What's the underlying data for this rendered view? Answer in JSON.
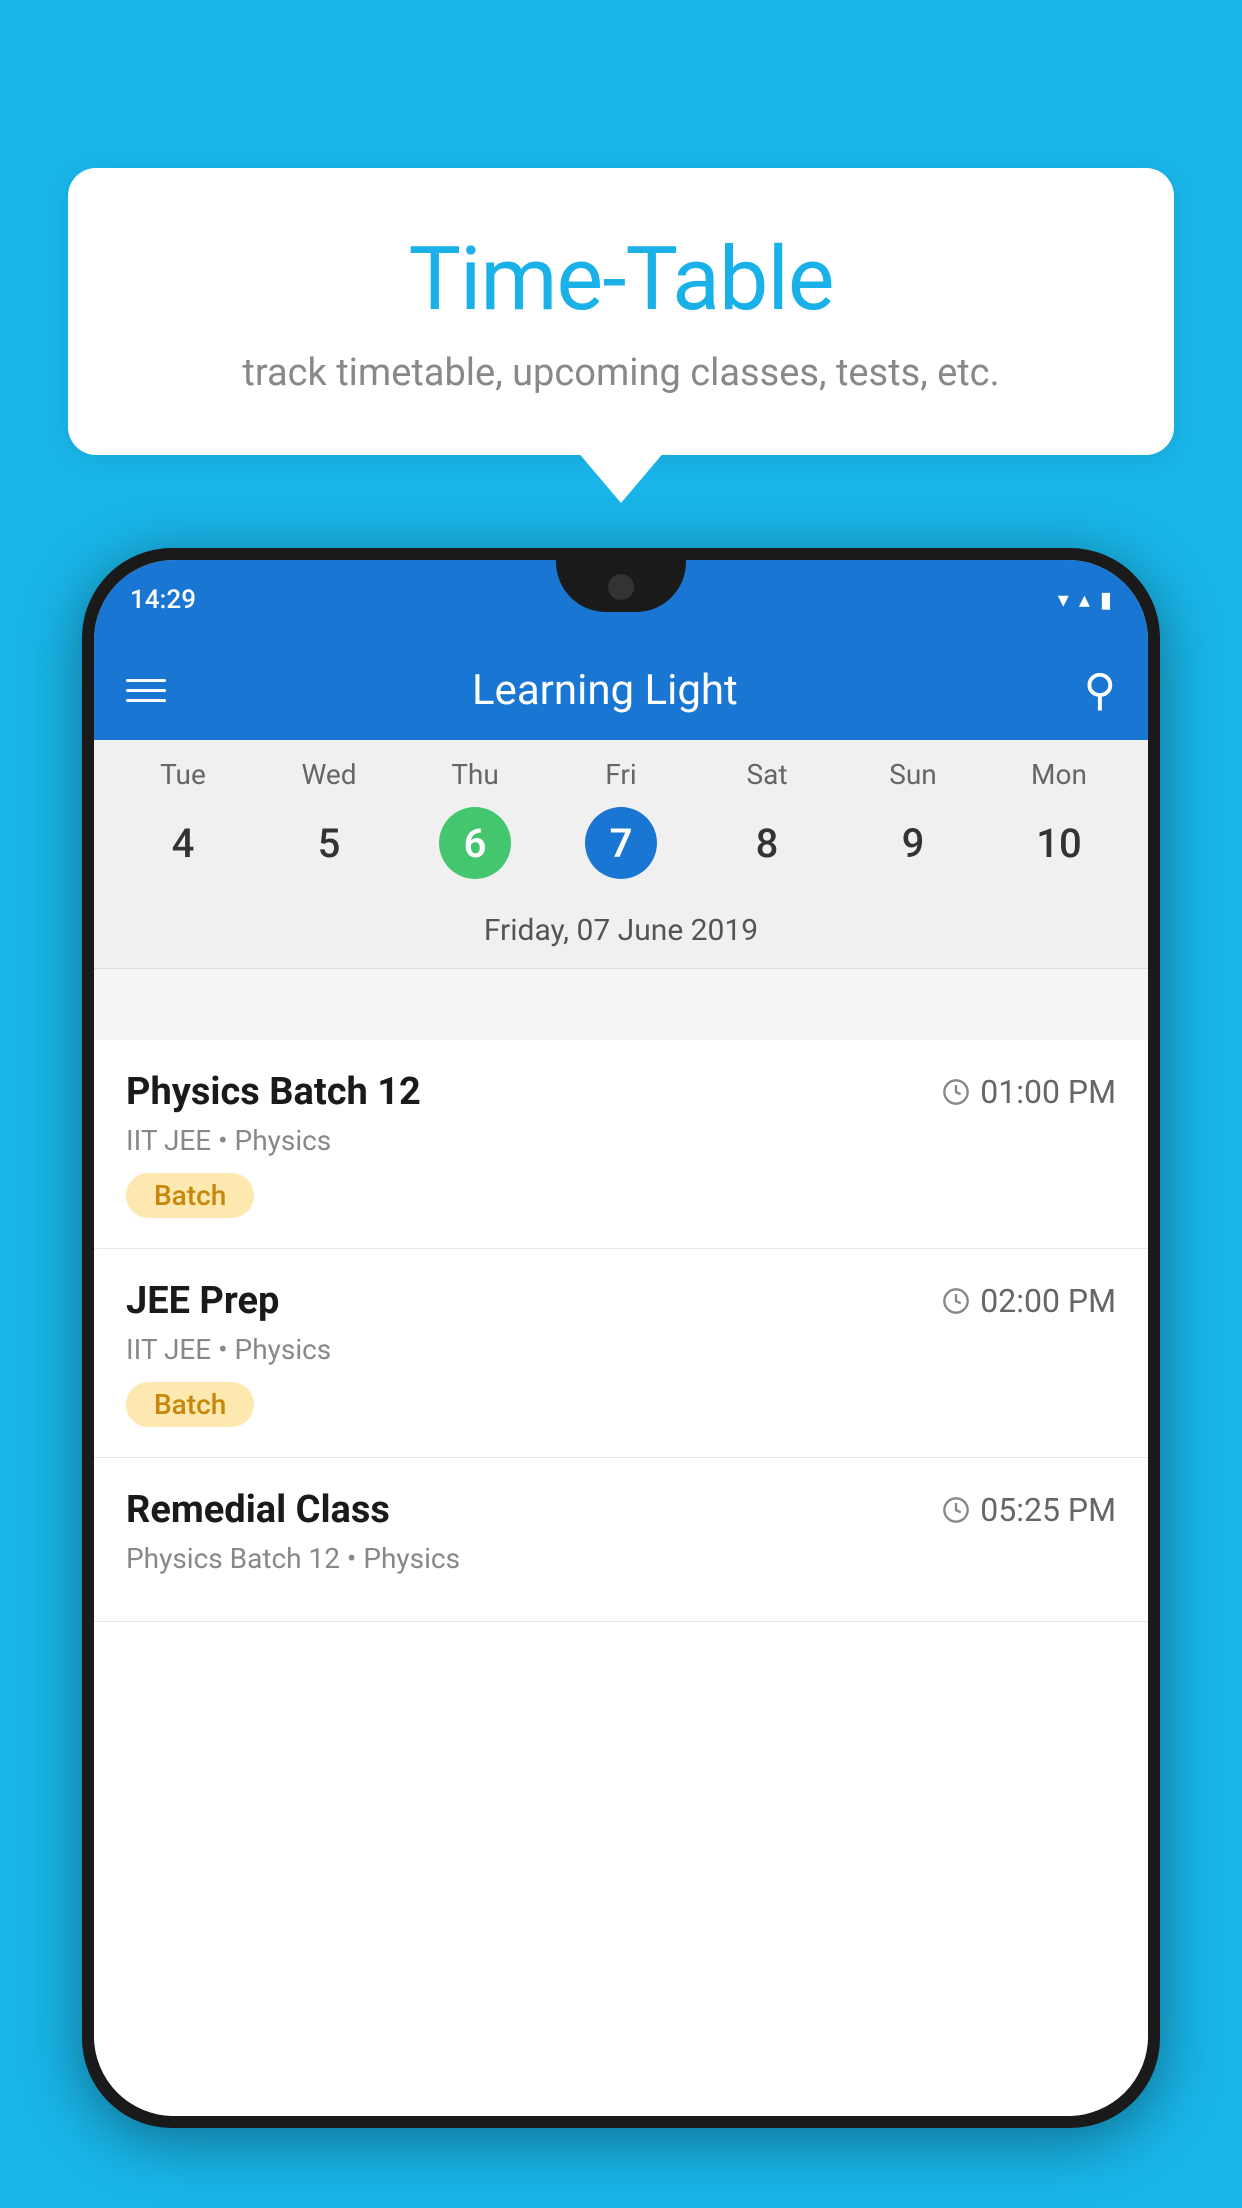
{
  "background_color": "#19b5e8",
  "bubble": {
    "title": "Time-Table",
    "subtitle": "track timetable, upcoming classes, tests, etc."
  },
  "status_bar": {
    "time": "14:29"
  },
  "toolbar": {
    "title": "Learning Light"
  },
  "calendar": {
    "weekdays": [
      "Tue",
      "Wed",
      "Thu",
      "Fri",
      "Sat",
      "Sun",
      "Mon"
    ],
    "dates": [
      "4",
      "5",
      "6",
      "7",
      "8",
      "9",
      "10"
    ],
    "today_index": 2,
    "selected_index": 3,
    "selected_date_label": "Friday, 07 June 2019"
  },
  "schedule": [
    {
      "title": "Physics Batch 12",
      "time": "01:00 PM",
      "subtitle": "IIT JEE • Physics",
      "badge": "Batch"
    },
    {
      "title": "JEE Prep",
      "time": "02:00 PM",
      "subtitle": "IIT JEE • Physics",
      "badge": "Batch"
    },
    {
      "title": "Remedial Class",
      "time": "05:25 PM",
      "subtitle": "Physics Batch 12 • Physics",
      "badge": ""
    }
  ]
}
